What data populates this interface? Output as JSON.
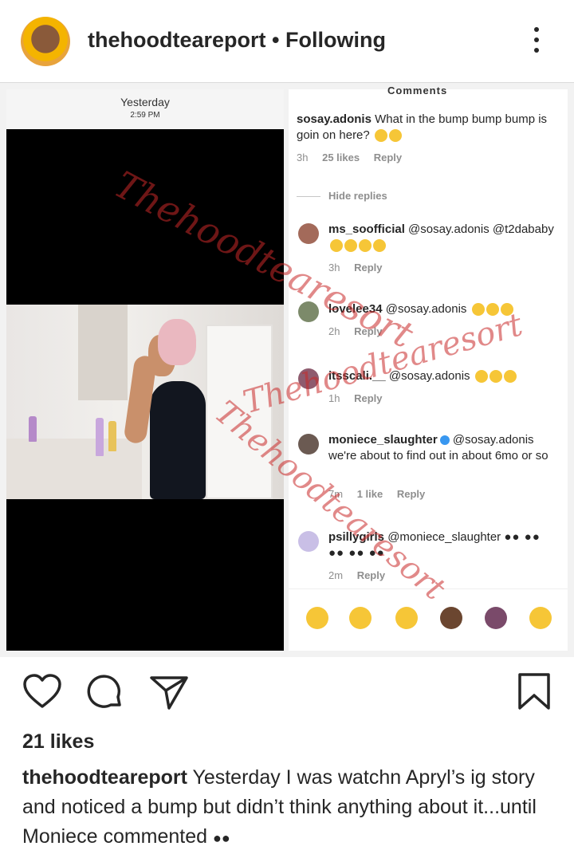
{
  "header": {
    "username": "thehoodteareport",
    "separator": " • ",
    "follow_label": "Following"
  },
  "story": {
    "day": "Yesterday",
    "time": "2:59 PM"
  },
  "comments_panel": {
    "title": "Comments",
    "top": {
      "user": "sosay.adonis",
      "text": "What in the bump bump bump is goin on here?",
      "age": "3h",
      "likes": "25 likes",
      "reply": "Reply"
    },
    "hide_replies": "Hide replies",
    "replies": [
      {
        "user": "ms_soofficial",
        "text": "@sosay.adonis @t2dababy",
        "age": "3h",
        "likes": "",
        "reply": "Reply"
      },
      {
        "user": "lovelee34",
        "text": "@sosay.adonis",
        "age": "2h",
        "likes": "",
        "reply": "Reply"
      },
      {
        "user": "itsscali.__",
        "text": "@sosay.adonis",
        "age": "1h",
        "likes": "",
        "reply": "Reply"
      },
      {
        "user": "moniece_slaughter",
        "text": "@sosay.adonis we're about to find out in about 6mo or so",
        "age": "7m",
        "likes": "1 like",
        "reply": "Reply"
      },
      {
        "user": "psillygirls",
        "text": "@moniece_slaughter",
        "age": "2m",
        "likes": "",
        "reply": "Reply"
      }
    ],
    "emoji_icons": [
      "rofl-emoji-icon",
      "weary-emoji-icon",
      "heart-eyes-emoji-icon",
      "clap-emoji-icon",
      "woman-facepalm-emoji-icon",
      "sob-emoji-icon"
    ]
  },
  "watermark": {
    "text": "Thehoodtearesort"
  },
  "actions": {
    "icons": [
      "heart-icon",
      "comment-icon",
      "share-icon",
      "bookmark-icon"
    ]
  },
  "post": {
    "likes": "21 likes",
    "caption_user": "thehoodteareport",
    "caption_text": "Yesterday I was watchn Apryl’s ig story and noticed a bump but didn’t think anything about it...until Moniece commented"
  }
}
